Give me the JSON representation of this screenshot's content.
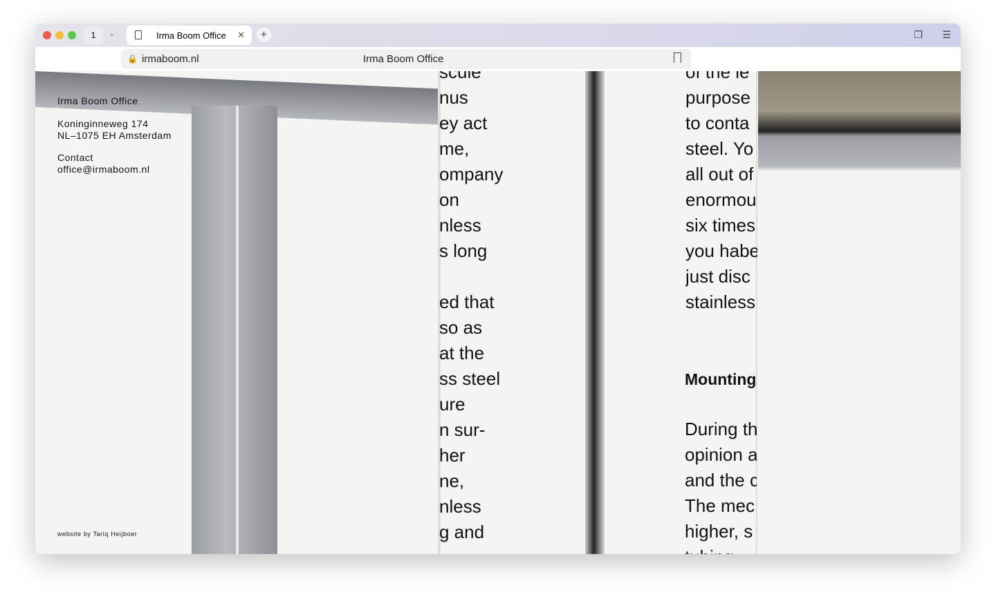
{
  "browser": {
    "tab_count": "1",
    "tab_title": "Irma Boom Office",
    "url": "irmaboom.nl",
    "page_title": "Irma Boom Office"
  },
  "site": {
    "name": "Irma Boom Office",
    "address_line1": "Koninginneweg 174",
    "address_line2": "NL–1075 EH Amsterdam",
    "contact_label": "Contact",
    "email": "office@irmaboom.nl",
    "credit": "website by Tariq Heijboer"
  },
  "photo_text": {
    "column1": "scule\nnus\ney act\nme,\nompany\non\nnless\ns long\n\ned that\nso as\nat the\nss steel\nure\nn sur-\nher\nne,\nnless\ng and",
    "column2": "of the le\npurpose\nto conta\nsteel. Yo\nall out of\nenormou\nsix times\nyou habe\njust disc\nstainless",
    "heading": "Mounting",
    "column3": "During th\nopinion a\nand the c\nThe mec\nhigher, s\ntubing"
  }
}
